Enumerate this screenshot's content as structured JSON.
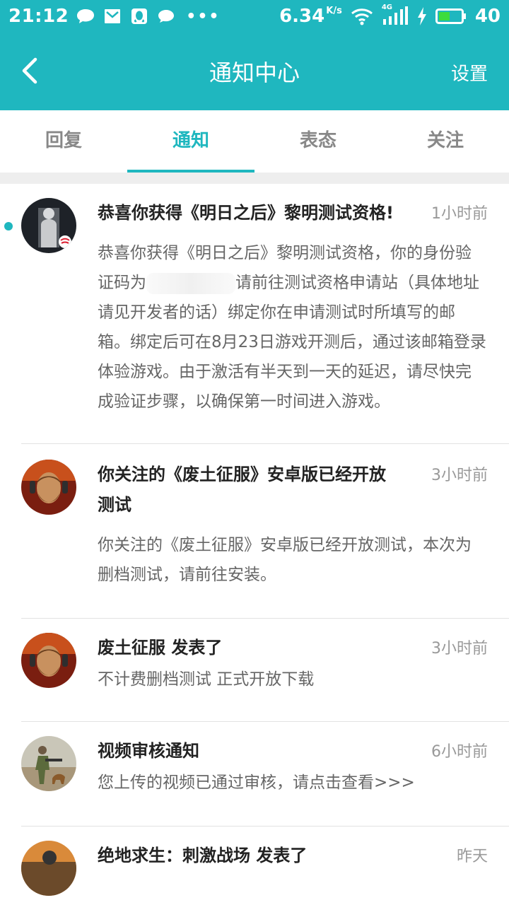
{
  "statusbar": {
    "time": "21:12",
    "speed": "6.34",
    "speed_unit": "K/s",
    "battery": "40",
    "signal_label": "4G"
  },
  "header": {
    "title": "通知中心",
    "settings_label": "设置"
  },
  "tabs": [
    {
      "label": "回复"
    },
    {
      "label": "通知"
    },
    {
      "label": "表态"
    },
    {
      "label": "关注"
    }
  ],
  "notifications": [
    {
      "title": "恭喜你获得《明日之后》黎明测试资格!",
      "time": "1小时前",
      "body_part1": "恭喜你获得《明日之后》黎明测试资格，你的身份验证码为",
      "body_part2": "请前往测试资格申请站（具体地址请见开发者的话）绑定你在申请测试时所填写的邮箱。绑定后可在8月23日游戏开测后，通过该邮箱登录体验游戏。由于激活有半天到一天的延迟，请尽快完成验证步骤，以确保第一时间进入游戏。"
    },
    {
      "title": "你关注的《废土征服》安卓版已经开放测试",
      "time": "3小时前",
      "body": "你关注的《废土征服》安卓版已经开放测试，本次为删档测试，请前往安装。"
    },
    {
      "title": "废土征服 发表了",
      "time": "3小时前",
      "body": "不计费删档测试 正式开放下载"
    },
    {
      "title": "视频审核通知",
      "time": "6小时前",
      "body": "您上传的视频已通过审核，请点击查看>>>"
    },
    {
      "title": "绝地求生：刺激战场 发表了",
      "time": "昨天"
    }
  ],
  "colors": {
    "accent": "#1fb7bf"
  }
}
